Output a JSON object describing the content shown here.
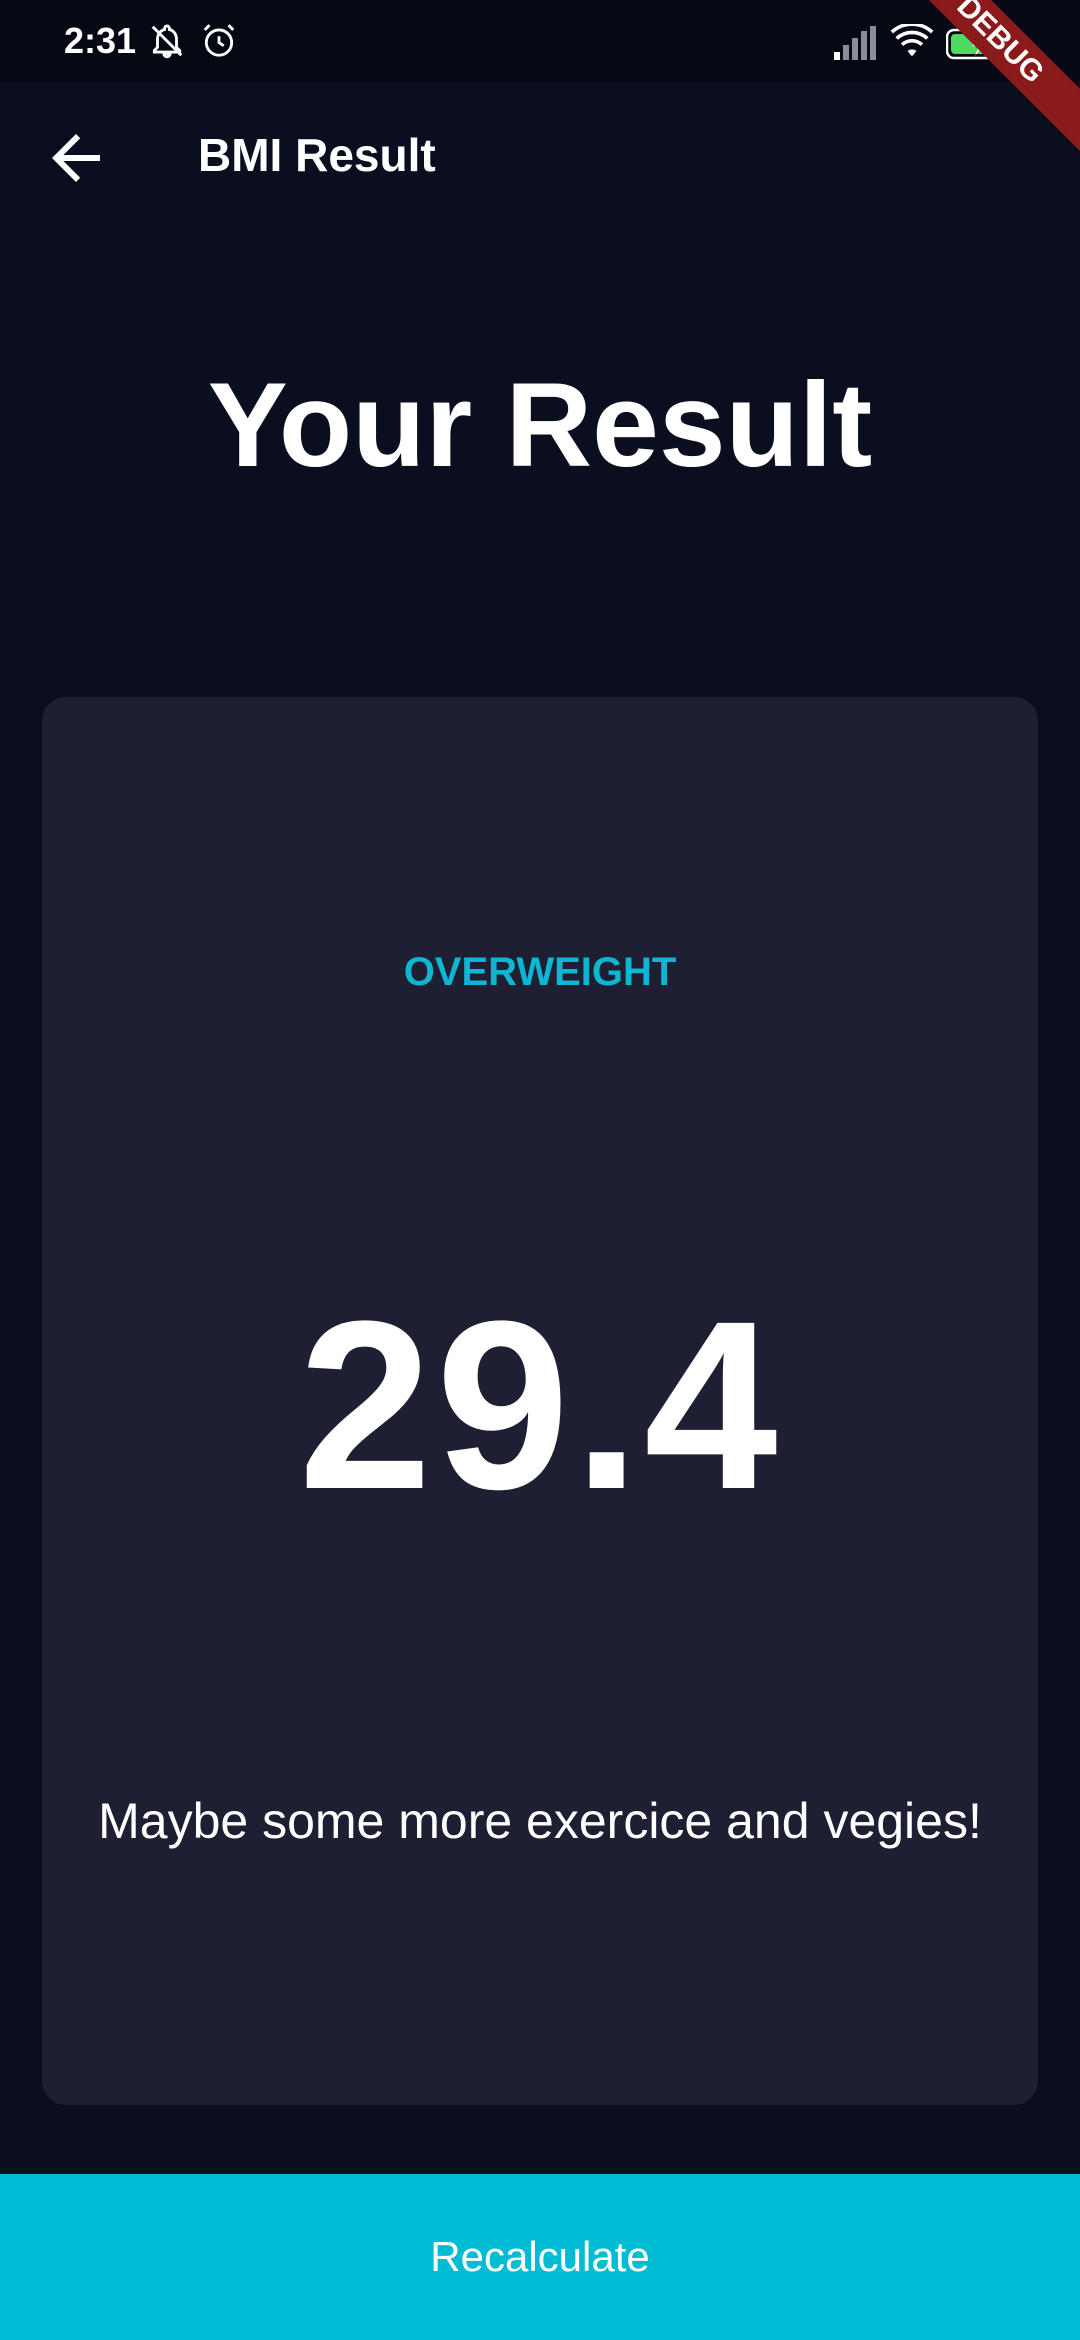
{
  "status_bar": {
    "time": "2:31",
    "icons": [
      "notifications-off-icon",
      "alarm-icon",
      "signal-icon",
      "wifi-icon",
      "battery-charging-icon"
    ]
  },
  "debug_banner": "DEBUG",
  "app_bar": {
    "back_icon": "arrow-back-icon",
    "title": "BMI Result"
  },
  "page_title": "Your Result",
  "result": {
    "category": "OVERWEIGHT",
    "bmi": "29.4",
    "advice": "Maybe some more exercice and vegies!"
  },
  "recalculate_label": "Recalculate",
  "colors": {
    "background": "#0b0e1e",
    "card": "#1e1f33",
    "accent": "#00bcd4",
    "category": "#0fb6d4",
    "debug_banner": "#8b1a1a"
  }
}
